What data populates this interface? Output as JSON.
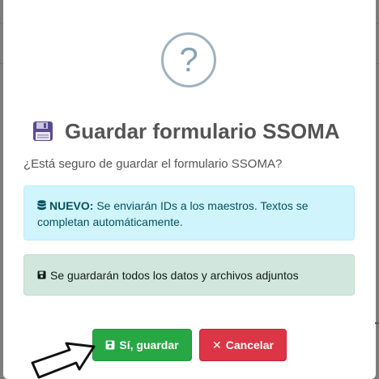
{
  "dialog": {
    "icon": "question-mark-icon",
    "icon_glyph": "?",
    "title_icon": "floppy-disk-icon",
    "title": "Guardar formulario SSOMA",
    "question": "¿Está seguro de guardar el formulario SSOMA?",
    "info_alert": {
      "icon": "database-icon",
      "label": "NUEVO:",
      "text": " Se enviarán IDs a los maestros. Textos se completan automáticamente."
    },
    "success_alert": {
      "icon": "save-icon",
      "text": "Se guardarán todos los datos y archivos adjuntos"
    },
    "buttons": {
      "confirm_icon": "save-icon",
      "confirm_label": "Sí, guardar",
      "cancel_icon": "close-icon",
      "cancel_glyph": "✕",
      "cancel_label": "Cancelar"
    }
  },
  "colors": {
    "confirm": "#28a745",
    "cancel": "#dc3545",
    "info_bg": "#cff4fc",
    "success_bg": "#d1e7dd",
    "question_icon": "#87a3b3"
  },
  "cursor": "hand-drawn-arrow-pointer-icon"
}
